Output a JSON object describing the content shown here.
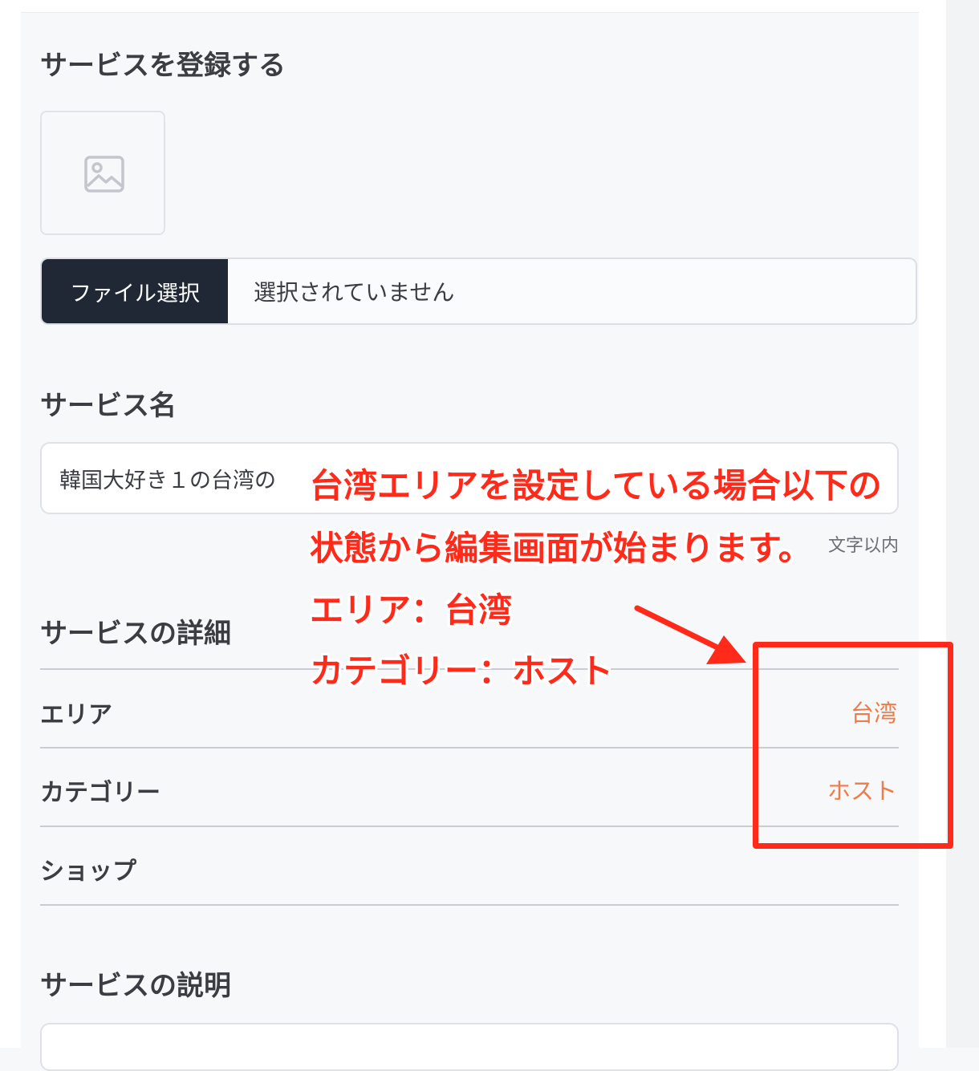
{
  "form": {
    "title": "サービスを登録する",
    "file_button_label": "ファイル選択",
    "file_status": "選択されていません",
    "service_name_heading": "サービス名",
    "service_name_value": "韓国大好き１の台湾の",
    "char_limit_note": "文字以内",
    "details_heading": "サービスの詳細",
    "details_rows": [
      {
        "label": "エリア",
        "value": "台湾"
      },
      {
        "label": "カテゴリー",
        "value": "ホスト"
      },
      {
        "label": "ショップ",
        "value": ""
      }
    ],
    "description_heading": "サービスの説明"
  },
  "annotation": {
    "lines": [
      "台湾エリアを設定している場合以下の",
      "状態から編集画面が始まります。",
      "エリア：台湾",
      "カテゴリー：ホスト"
    ],
    "color": "#ff2a1a"
  },
  "colors": {
    "accent_value": "#ee7c4b",
    "file_button_bg": "#202836"
  }
}
